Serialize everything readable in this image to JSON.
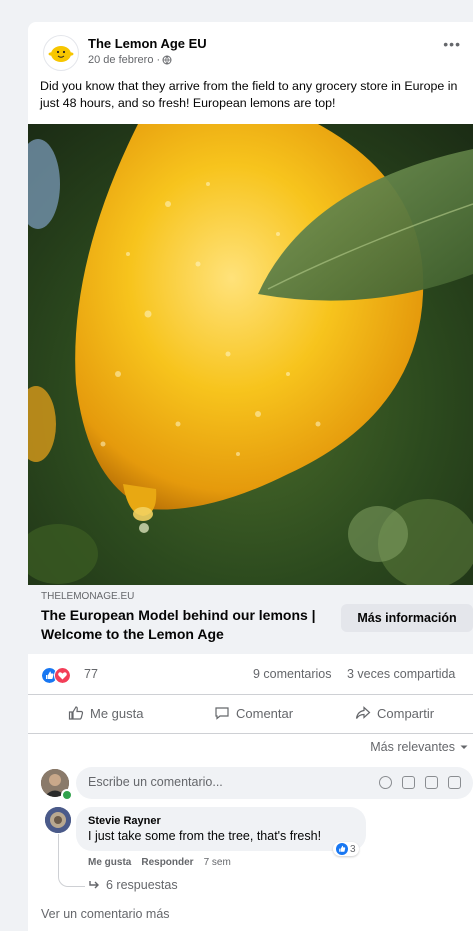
{
  "post": {
    "page_name": "The Lemon Age EU",
    "date": "20 de febrero ·",
    "text": "Did you know that they arrive from the field to any grocery store in Europe in just 48 hours, and so fresh! European lemons are top!",
    "more_icon": "•••",
    "privacy_icon": "globe-icon"
  },
  "link": {
    "domain": "THELEMONAGE.EU",
    "title": "The European Model behind our lemons | Welcome to the Lemon Age",
    "button": "Más información"
  },
  "stats": {
    "reactions": "77",
    "reaction_types": [
      "like",
      "love"
    ],
    "comments": "9 comentarios",
    "shares": "3 veces compartida"
  },
  "actions": {
    "like": "Me gusta",
    "comment": "Comentar",
    "share": "Compartir"
  },
  "sort": {
    "label": "Más relevantes"
  },
  "composer": {
    "placeholder": "Escribe un comentario..."
  },
  "comment": {
    "author": "Stevie Rayner",
    "text": "I just take some from the tree, that's fresh!",
    "like": "Me gusta",
    "reply": "Responder",
    "time": "7 sem",
    "reaction_count": "3",
    "replies": "6 respuestas"
  },
  "more_comments": "Ver un comentario más",
  "colors": {
    "like_blue": "#1877f2",
    "love_red": "#f33e58",
    "muted": "#65676b"
  }
}
